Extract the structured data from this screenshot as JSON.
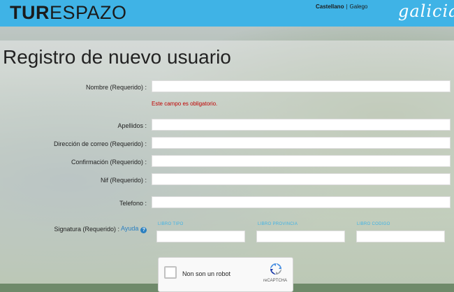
{
  "header": {
    "brand_bold": "TUR",
    "brand_rest": "ESPAZO",
    "lang_active": "Castellano",
    "lang_separator": "|",
    "lang_other": "Galego",
    "logo_text": "galicia"
  },
  "form": {
    "title": "Registro de nuevo usuario",
    "fields": {
      "nombre_label": "Nombre (Requerido) :",
      "nombre_error": "Este campo es obligatorio.",
      "apellidos_label": "Apellidos :",
      "correo_label": "Dirección de correo (Requerido) :",
      "confirmacion_label": "Confirmación (Requerido) :",
      "nif_label": "Nif (Requerido) :",
      "telefono_label": "Telefono :",
      "signatura_label": "Signatura (Requerido) :",
      "signatura_help": "Ayuda",
      "libro_tipo": "LIBRO TIPO",
      "libro_provincia": "LIBRO PROVINCIA",
      "libro_codigo": "LIBRO CODIGO"
    },
    "captcha": {
      "label": "Non son un robot",
      "brand": "reCAPTCHA"
    }
  },
  "colors": {
    "header_bg": "#3fb3e6",
    "error": "#c00000",
    "help_link": "#2a7fc0"
  }
}
